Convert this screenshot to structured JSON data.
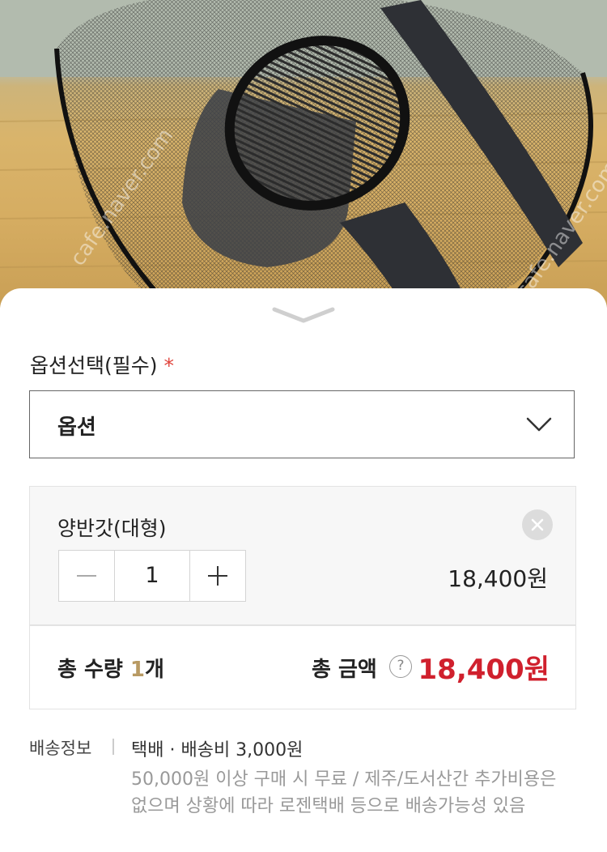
{
  "photo": {
    "watermark": "cafe.naver.com"
  },
  "sheet": {
    "option_label": "옵션선택(필수)",
    "required_mark": "*",
    "select": {
      "value": "옵션"
    },
    "item": {
      "name": "양반갓(대형)",
      "quantity": "1",
      "price": "18,400원"
    },
    "totals": {
      "qty_label": "총 수량 ",
      "qty_num": "1",
      "qty_unit": "개",
      "amount_label": "총 금액",
      "help": "?",
      "amount_value": "18,400원"
    },
    "shipping": {
      "label": "배송정보",
      "main": "택배 · 배송비 3,000원",
      "note": "50,000원 이상 구매 시 무료 / 제주/도서산간 추가비용은 없으며 상황에 따라 로젠택배 등으로 배송가능성 있음"
    },
    "colors": {
      "accent_price": "#d0202d",
      "required": "#e0443c"
    }
  }
}
